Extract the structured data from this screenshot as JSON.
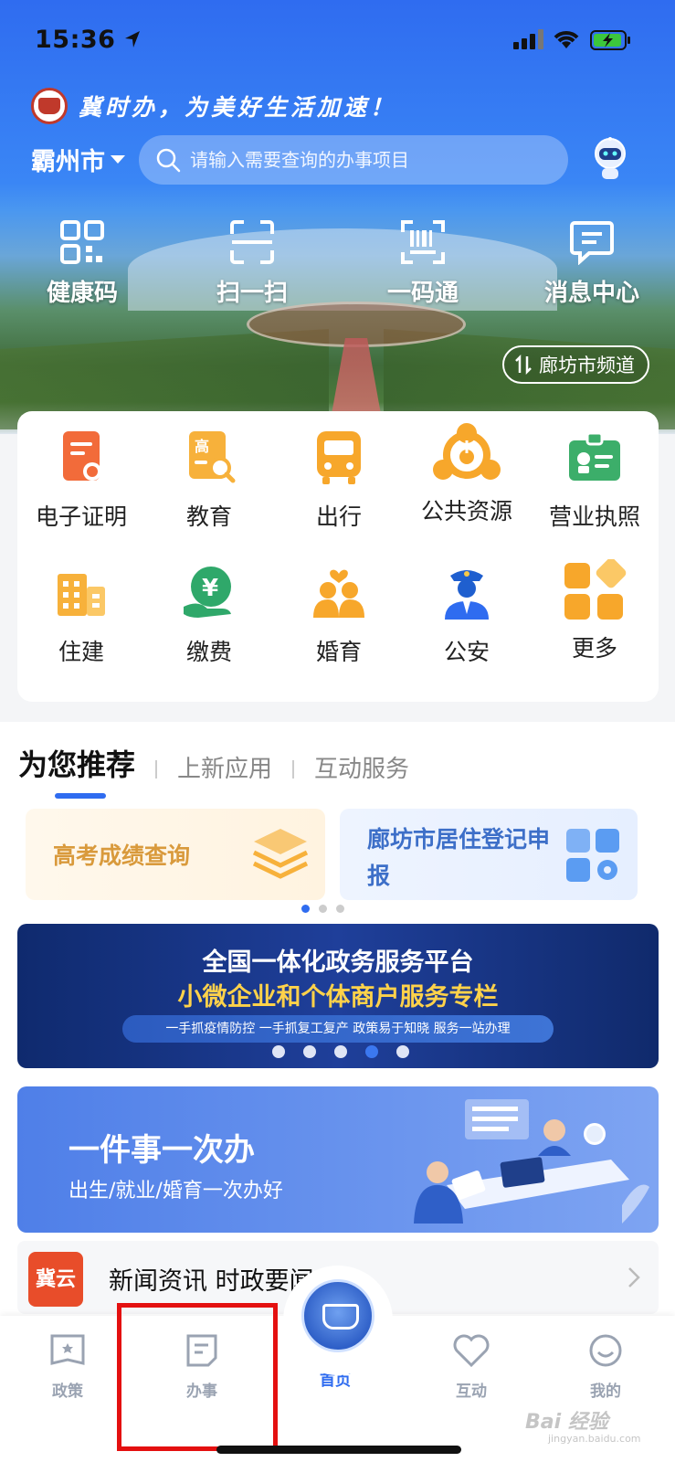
{
  "status_bar": {
    "time": "15:36"
  },
  "header": {
    "slogan": "冀时办，为美好生活加速！",
    "city": "霸州市",
    "search_placeholder": "请输入需要查询的办事项目",
    "channel_label": "廊坊市频道"
  },
  "quick_actions": [
    {
      "label": "健康码",
      "icon": "health-code-icon"
    },
    {
      "label": "扫一扫",
      "icon": "scan-icon"
    },
    {
      "label": "一码通",
      "icon": "barcode-icon"
    },
    {
      "label": "消息中心",
      "icon": "message-icon"
    }
  ],
  "services": [
    {
      "label": "电子证明",
      "icon": "certificate-icon"
    },
    {
      "label": "教育",
      "icon": "education-icon"
    },
    {
      "label": "出行",
      "icon": "bus-icon"
    },
    {
      "label": "公共资源",
      "icon": "public-resource-icon"
    },
    {
      "label": "营业执照",
      "icon": "business-license-icon"
    },
    {
      "label": "住建",
      "icon": "building-icon"
    },
    {
      "label": "缴费",
      "icon": "payment-icon"
    },
    {
      "label": "婚育",
      "icon": "marriage-icon"
    },
    {
      "label": "公安",
      "icon": "police-icon"
    },
    {
      "label": "更多",
      "icon": "more-icon"
    }
  ],
  "recommend": {
    "tabs": [
      "为您推荐",
      "上新应用",
      "互动服务"
    ],
    "active_tab": "为您推荐",
    "cards": [
      {
        "title": "高考成绩查询"
      },
      {
        "title": "廊坊市居住登记申报"
      }
    ]
  },
  "banner": {
    "line1": "全国一体化政务服务平台",
    "line2": "小微企业和个体商户服务专栏",
    "tagline": "一手抓疫情防控   一手抓复工复产   政策易于知晓   服务一站办理"
  },
  "one_thing": {
    "title": "一件事一次办",
    "subtitle": "出生/就业/婚育一次办好"
  },
  "news": {
    "logo_text": "冀云",
    "title": "新闻资讯 时政要闻"
  },
  "tab_bar": [
    {
      "label": "政策",
      "icon": "policy-icon"
    },
    {
      "label": "办事",
      "icon": "affairs-icon"
    },
    {
      "label": "首页",
      "icon": "home-emblem-icon"
    },
    {
      "label": "互动",
      "icon": "heart-icon"
    },
    {
      "label": "我的",
      "icon": "profile-icon"
    }
  ],
  "watermark": {
    "text": "Bai 经验",
    "sub": "jingyan.baidu.com"
  },
  "colors": {
    "primary": "#2f6cf0",
    "highlight_box": "#e41010",
    "orange": "#f5a623"
  }
}
